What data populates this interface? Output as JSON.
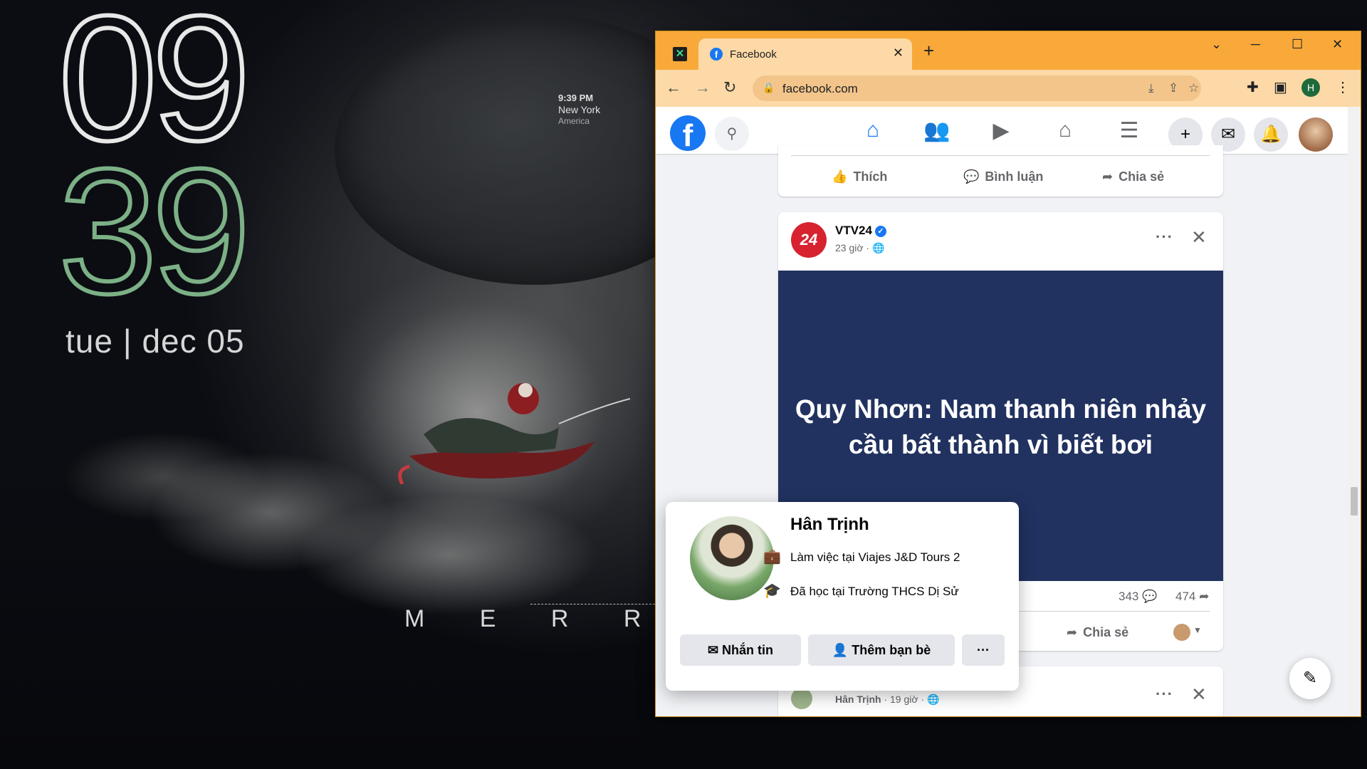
{
  "desktop": {
    "clock_hour": "09",
    "clock_minute": "39",
    "date": "tue | dec 05",
    "world_clock": {
      "time": "9:39 PM",
      "city": "New York",
      "region": "America"
    },
    "banner": "M E R R Y C"
  },
  "browser": {
    "tab_title": "Facebook",
    "url": "facebook.com",
    "profile_initial": "H",
    "accent": "#f8a93a"
  },
  "facebook": {
    "prev_post_actions": {
      "like": "Thích",
      "comment": "Bình luận",
      "share": "Chia sẻ"
    },
    "post": {
      "page_avatar_text": "24",
      "page_name": "VTV24",
      "time": "23 giờ ·",
      "headline": "Quy Nhơn: Nam thanh niên nhảy cầu bất thành vì biết bơi",
      "comments": "343",
      "shares": "474",
      "share_label": "Chia sẻ",
      "image_color": "#213260"
    },
    "next_post": {
      "author": "Hân Trịnh",
      "time": "· 19 giờ ·"
    }
  },
  "hovercard": {
    "name": "Hân Trịnh",
    "work_prefix": "Làm việc tại ",
    "work_place": "Viajes J&D Tours 2",
    "edu_prefix": "Đã học tại ",
    "edu_place": "Trường THCS Dị Sử",
    "message_label": "Nhắn tin",
    "add_friend_label": "Thêm bạn bè",
    "more_label": "···"
  }
}
